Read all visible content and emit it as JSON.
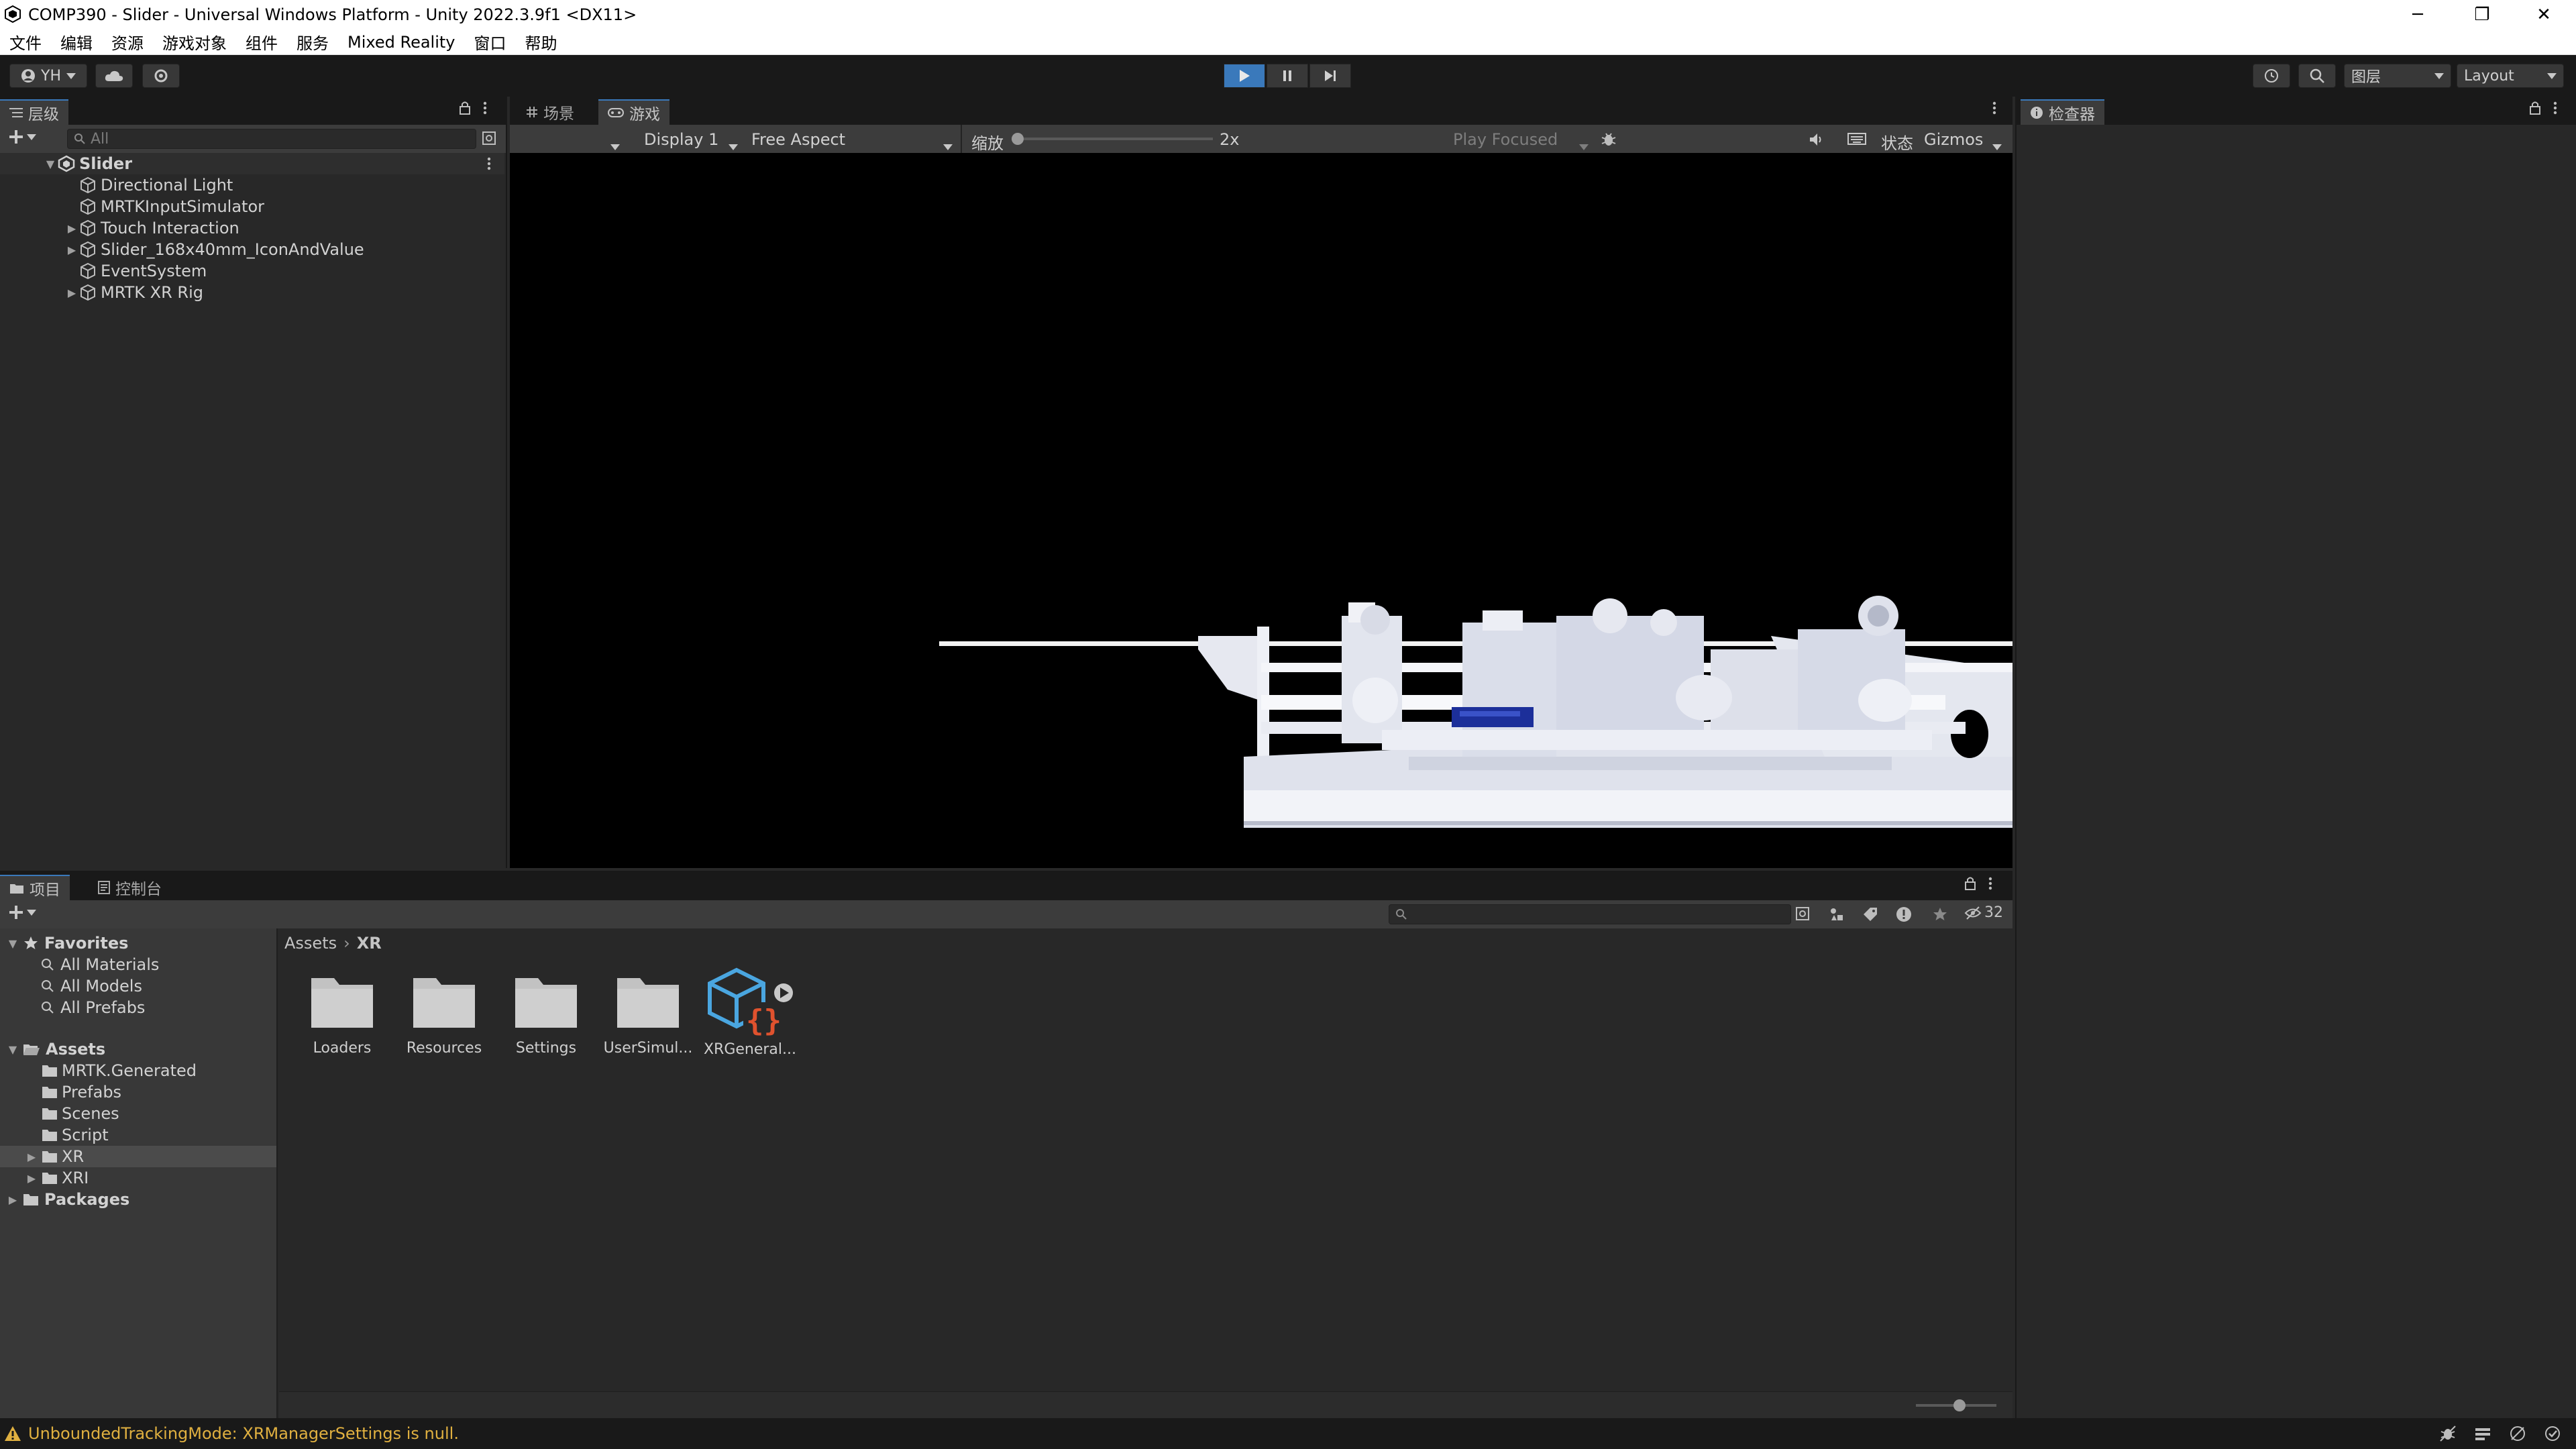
{
  "window": {
    "title": "COMP390 - Slider - Universal Windows Platform - Unity 2022.3.9f1 <DX11>",
    "minimize_glyph": "─",
    "restore_glyph": "❐",
    "close_glyph": "✕"
  },
  "menu": [
    "文件",
    "编辑",
    "资源",
    "游戏对象",
    "组件",
    "服务",
    "Mixed Reality",
    "窗口",
    "帮助"
  ],
  "toolbar": {
    "account_label": "YH",
    "layers_label": "图层",
    "layout_label": "Layout",
    "play_active": true,
    "accent": "#3a79bb"
  },
  "hierarchy": {
    "tab_label": "层级",
    "search_placeholder": "All",
    "scene_name": "Slider",
    "items": [
      {
        "label": "Directional Light",
        "has_children": false
      },
      {
        "label": "MRTKInputSimulator",
        "has_children": false
      },
      {
        "label": "Touch Interaction",
        "has_children": true
      },
      {
        "label": "Slider_168x40mm_IconAndValue",
        "has_children": true
      },
      {
        "label": "EventSystem",
        "has_children": false
      },
      {
        "label": "MRTK XR Rig",
        "has_children": true
      }
    ]
  },
  "gameview": {
    "tab_scene": "场景",
    "tab_game": "游戏",
    "display": "Display 1",
    "aspect": "Free Aspect",
    "scale_label": "缩放",
    "scale_value": "2x",
    "play_mode": "Play Focused",
    "stats_label": "状态",
    "gizmos_label": "Gizmos"
  },
  "inspector": {
    "tab_label": "检查器"
  },
  "project": {
    "tab_project": "项目",
    "tab_console": "控制台",
    "hidden_count": "32",
    "favorites_label": "Favorites",
    "favorites": [
      "All Materials",
      "All Models",
      "All Prefabs"
    ],
    "assets_label": "Assets",
    "asset_folders": [
      {
        "label": "MRTK.Generated",
        "has_children": false,
        "selected": false
      },
      {
        "label": "Prefabs",
        "has_children": false,
        "selected": false
      },
      {
        "label": "Scenes",
        "has_children": false,
        "selected": false
      },
      {
        "label": "Script",
        "has_children": false,
        "selected": false
      },
      {
        "label": "XR",
        "has_children": true,
        "selected": true
      },
      {
        "label": "XRI",
        "has_children": true,
        "selected": false
      }
    ],
    "packages_label": "Packages",
    "breadcrumb": [
      "Assets",
      "XR"
    ],
    "grid_items": [
      {
        "label": "Loaders",
        "kind": "folder"
      },
      {
        "label": "Resources",
        "kind": "folder"
      },
      {
        "label": "Settings",
        "kind": "folder"
      },
      {
        "label": "UserSimul...",
        "kind": "folder"
      },
      {
        "label": "XRGeneral...",
        "kind": "asset"
      }
    ]
  },
  "status": {
    "message": "UnboundedTrackingMode: XRManagerSettings is null.",
    "warning_color": "#e0b040"
  }
}
